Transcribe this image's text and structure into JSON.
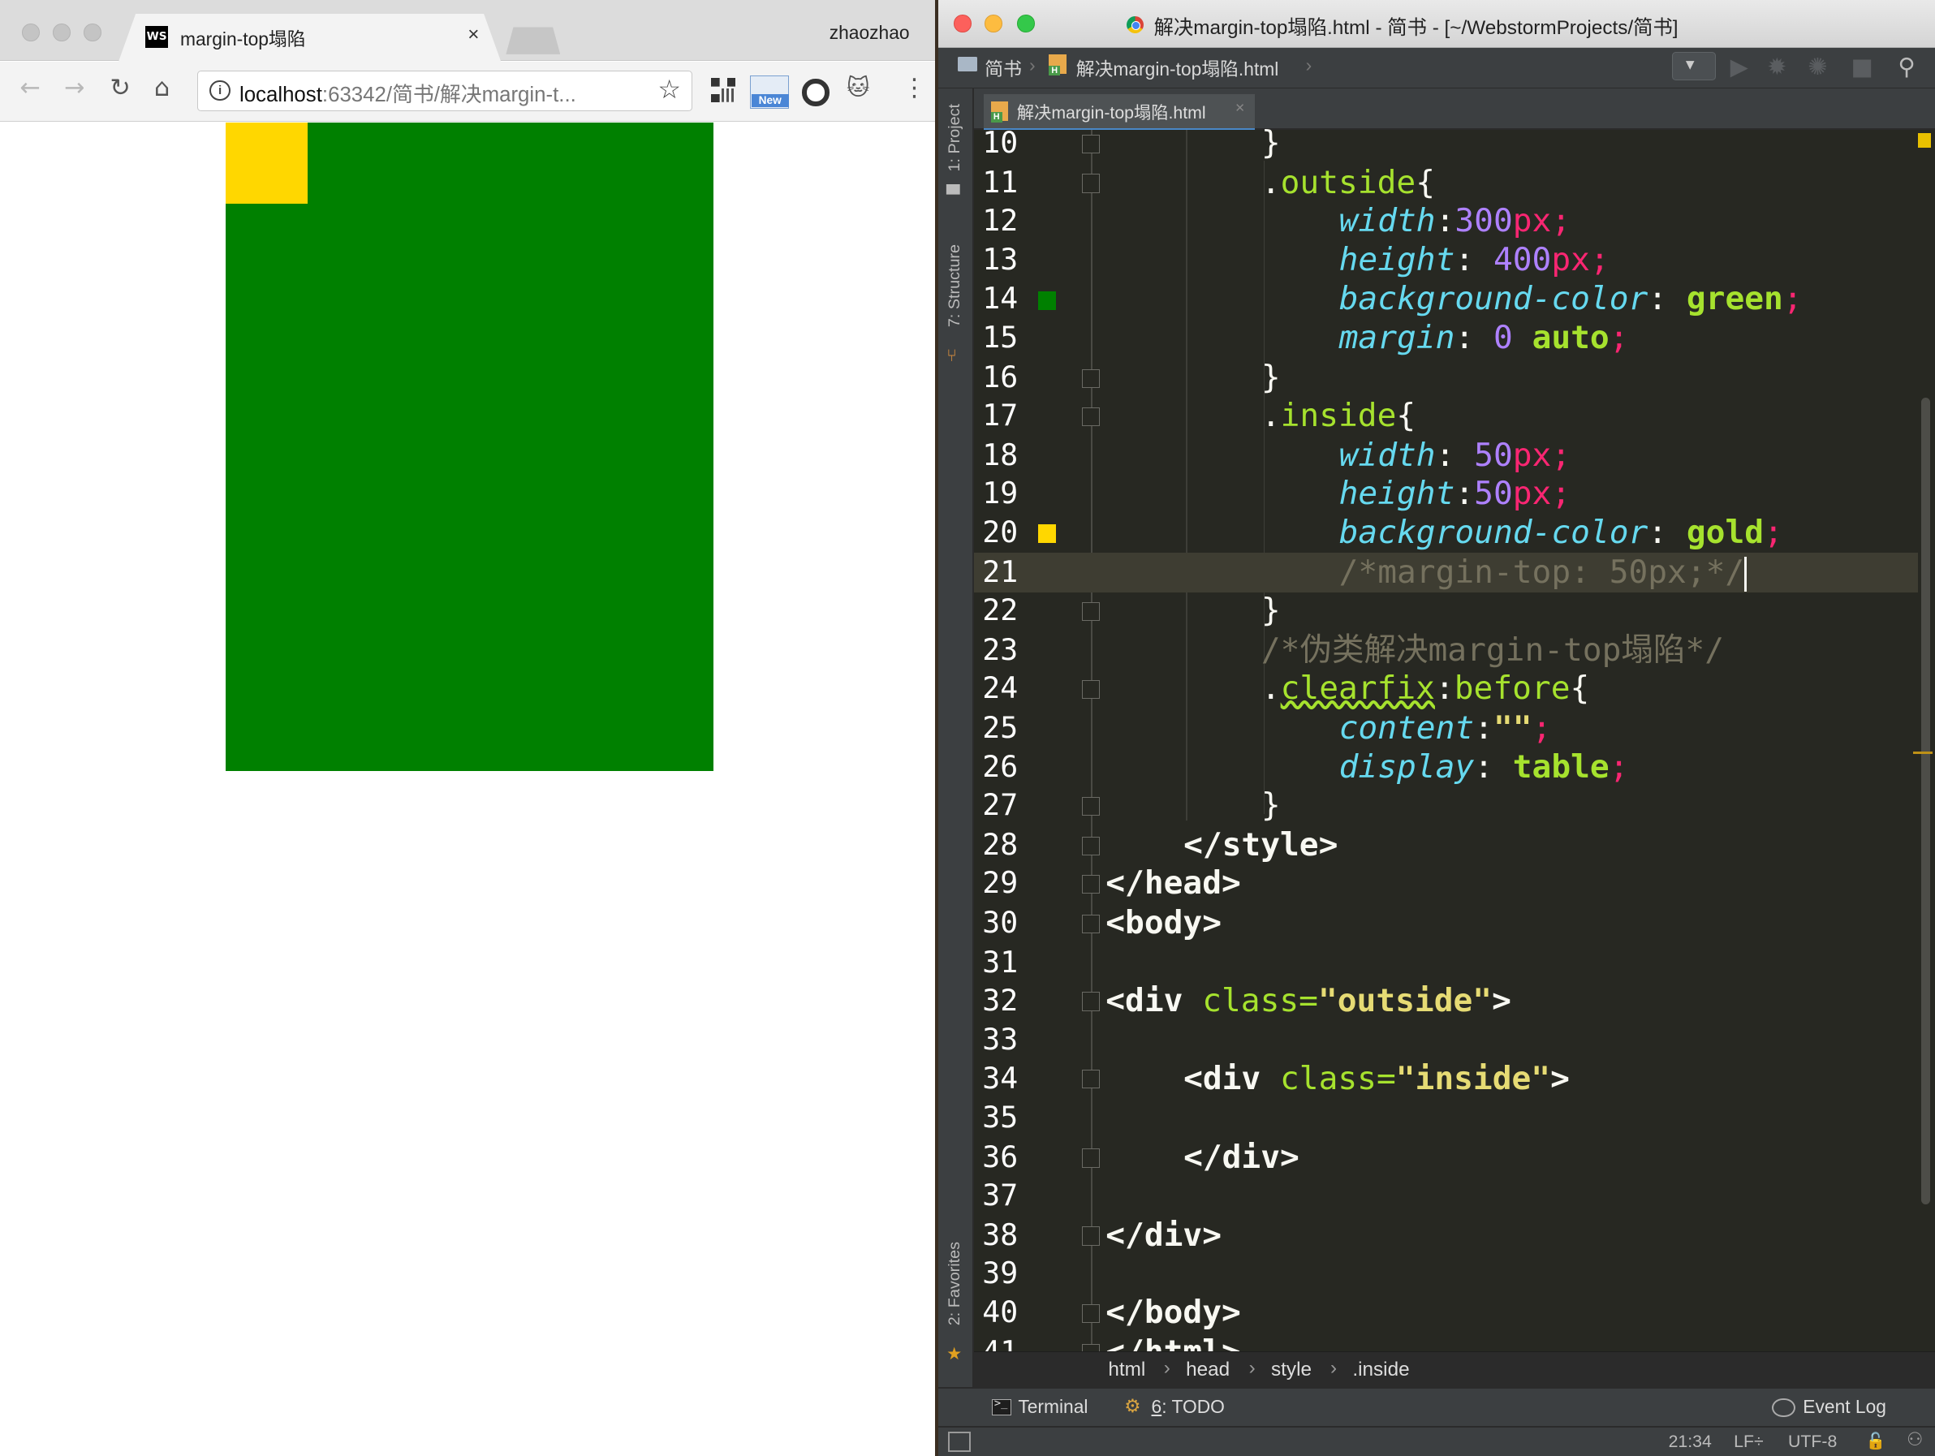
{
  "browser": {
    "tab_title": "margin-top塌陷",
    "tab_favicon_text": "WS",
    "tab_close": "×",
    "profile_name": "zhaozhao",
    "url_host": "localhost",
    "url_rest": ":63342/简书/解决margin-t...",
    "new_badge": "New",
    "page": {
      "outside_color": "#008000",
      "inside_color": "#ffd700"
    }
  },
  "ide": {
    "window_title": "解决margin-top塌陷.html - 简书 - [~/WebstormProjects/简书]",
    "nav_project": "简书",
    "nav_file": "解决margin-top塌陷.html",
    "editor_tab": "解决margin-top塌陷.html",
    "tool_tabs": {
      "project": "1: Project",
      "structure": "7: Structure",
      "favorites": "2: Favorites"
    },
    "code_lines": [
      {
        "n": "10",
        "indent": 8,
        "html": "<span>}</span>"
      },
      {
        "n": "11",
        "indent": 8,
        "html": "<span>.</span><span class='sel'>outside</span><span>{</span>"
      },
      {
        "n": "12",
        "indent": 12,
        "html": "<span class='kw'>width</span><span>:</span><span class='num'>300</span><span class='unit'>px</span><span class='pun'>;</span>"
      },
      {
        "n": "13",
        "indent": 12,
        "html": "<span class='kw'>height</span><span>: </span><span class='num'>400</span><span class='unit'>px</span><span class='pun'>;</span>"
      },
      {
        "n": "14",
        "indent": 12,
        "html": "<span class='kw'>background-color</span><span>: </span><span class='val'>green</span><span class='pun'>;</span>"
      },
      {
        "n": "15",
        "indent": 12,
        "html": "<span class='kw'>margin</span><span>: </span><span class='num'>0</span><span> </span><span class='val'>auto</span><span class='pun'>;</span>"
      },
      {
        "n": "16",
        "indent": 8,
        "html": "<span>}</span>"
      },
      {
        "n": "17",
        "indent": 8,
        "html": "<span>.</span><span class='sel'>inside</span><span>{</span>"
      },
      {
        "n": "18",
        "indent": 12,
        "html": "<span class='kw'>width</span><span>: </span><span class='num'>50</span><span class='unit'>px</span><span class='pun'>;</span>"
      },
      {
        "n": "19",
        "indent": 12,
        "html": "<span class='kw'>height</span><span>:</span><span class='num'>50</span><span class='unit'>px</span><span class='pun'>;</span>"
      },
      {
        "n": "20",
        "indent": 12,
        "html": "<span class='kw'>background-color</span><span>: </span><span class='val'>gold</span><span class='pun'>;</span>"
      },
      {
        "n": "21",
        "indent": 12,
        "html": "<span class='cmt'>/*margin-top: 50px;*/</span><span class='caret'></span>"
      },
      {
        "n": "22",
        "indent": 8,
        "html": "<span>}</span>"
      },
      {
        "n": "23",
        "indent": 8,
        "html": "<span class='cmt'>/*伪类解决margin-top塌陷*/</span>"
      },
      {
        "n": "24",
        "indent": 8,
        "html": "<span>.</span><span class='sel' style='text-decoration: underline wavy #a6e22e;'>clearfix</span><span>:</span><span class='sel'>before</span><span>{</span>"
      },
      {
        "n": "25",
        "indent": 12,
        "html": "<span class='kw'>content</span><span>:</span><span class='str'>\"\"</span><span class='pun'>;</span>"
      },
      {
        "n": "26",
        "indent": 12,
        "html": "<span class='kw'>display</span><span>: </span><span class='val'>table</span><span class='pun'>;</span>"
      },
      {
        "n": "27",
        "indent": 8,
        "html": "<span>}</span>"
      },
      {
        "n": "28",
        "indent": 4,
        "html": "<span class='tag'>&lt;/style&gt;</span>"
      },
      {
        "n": "29",
        "indent": 0,
        "html": "<span class='tag'>&lt;/head&gt;</span>"
      },
      {
        "n": "30",
        "indent": 0,
        "html": "<span class='tag'>&lt;body&gt;</span>"
      },
      {
        "n": "31",
        "indent": 0,
        "html": ""
      },
      {
        "n": "32",
        "indent": 0,
        "html": "<span class='tag'>&lt;div </span><span class='attr'>class=</span><span class='str'>\"outside\"</span><span class='tag'>&gt;</span>"
      },
      {
        "n": "33",
        "indent": 0,
        "html": ""
      },
      {
        "n": "34",
        "indent": 4,
        "html": "<span class='tag'>&lt;div </span><span class='attr'>class=</span><span class='str'>\"inside\"</span><span class='tag'>&gt;</span>"
      },
      {
        "n": "35",
        "indent": 0,
        "html": ""
      },
      {
        "n": "36",
        "indent": 4,
        "html": "<span class='tag'>&lt;/div&gt;</span>"
      },
      {
        "n": "37",
        "indent": 0,
        "html": ""
      },
      {
        "n": "38",
        "indent": 0,
        "html": "<span class='tag'>&lt;/div&gt;</span>"
      },
      {
        "n": "39",
        "indent": 0,
        "html": ""
      },
      {
        "n": "40",
        "indent": 0,
        "html": "<span class='tag'>&lt;/body&gt;</span>"
      },
      {
        "n": "41",
        "indent": 0,
        "html": "<span class='tag'>&lt;/html&gt;</span>"
      }
    ],
    "current_line": "21",
    "breadcrumb": [
      "html",
      "head",
      "style",
      ".inside"
    ],
    "tool_window_tabs": {
      "terminal": "Terminal",
      "todo_num": "6",
      "todo_label": ": TODO",
      "event_log": "Event Log"
    },
    "status": {
      "position": "21:34",
      "line_sep": "LF÷",
      "encoding": "UTF-8"
    },
    "swatches": {
      "line14": "#008000",
      "line20": "#ffd700"
    }
  }
}
